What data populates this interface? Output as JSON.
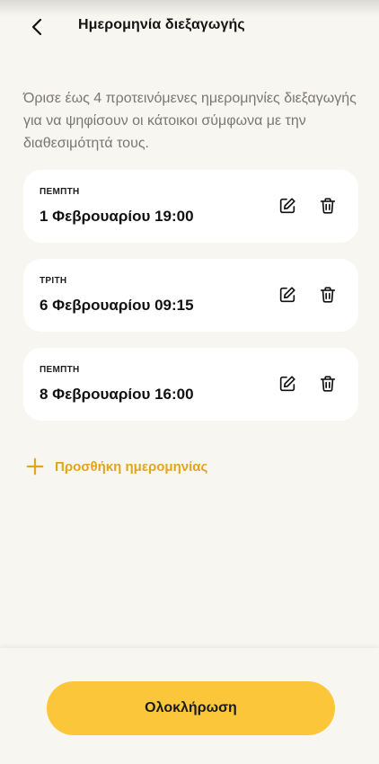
{
  "header": {
    "title": "Ημερομηνία διεξαγωγής",
    "back_icon": "chevron-left-icon"
  },
  "intro": "Όρισε έως 4 προτεινόμενες ημερομηνίες διεξαγωγής για να ψηφίσουν οι κάτοικοι σύμφωνα με την διαθεσιμότητά τους.",
  "dates": [
    {
      "day": "ΠΕΜΠΤΗ",
      "date": "1 Φεβρουαρίου 19:00"
    },
    {
      "day": "ΤΡΙΤΗ",
      "date": "6 Φεβρουαρίου 09:15"
    },
    {
      "day": "ΠΕΜΠΤΗ",
      "date": "8 Φεβρουαρίου 16:00"
    }
  ],
  "add": {
    "label": "Προσθήκη ημερομηνίας",
    "icon": "plus-icon"
  },
  "footer": {
    "complete_label": "Ολοκλήρωση"
  },
  "colors": {
    "accent": "#fbc63a",
    "accent_text": "#e3a51c",
    "background": "#f8f6f1",
    "card": "#ffffff"
  }
}
